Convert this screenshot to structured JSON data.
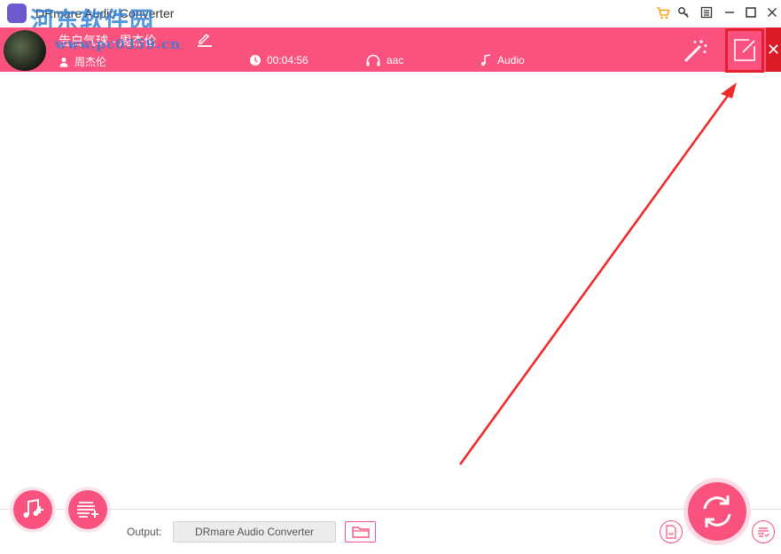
{
  "window": {
    "title": "DRmare Audio Converter",
    "watermark": "河东软件园",
    "watermark_url": "www.pc0359.cn"
  },
  "track": {
    "title": "告白气球 - 周杰伦",
    "artist": "周杰伦",
    "duration": "00:04:56",
    "format": "aac",
    "type": "Audio"
  },
  "bottom": {
    "output_label": "Output:",
    "output_path": "DRmare Audio Converter"
  },
  "colors": {
    "accent": "#f9527e",
    "highlight": "#e5212e"
  },
  "icons": {
    "add_music": "music-add-icon",
    "add_list": "list-add-icon",
    "folder": "folder-icon",
    "convert": "refresh-icon",
    "edit": "edit-icon",
    "wand": "magic-wand-icon"
  }
}
